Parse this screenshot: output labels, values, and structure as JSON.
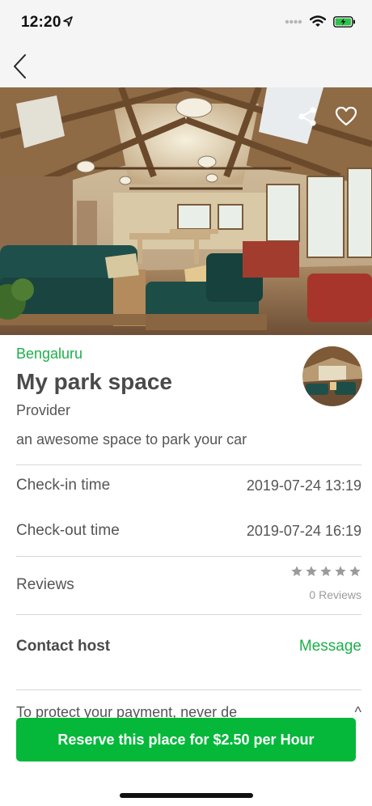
{
  "status_bar": {
    "time": "12:20",
    "icons": [
      "location-arrow-icon",
      "signal-dots-icon",
      "wifi-icon",
      "battery-charging-icon"
    ]
  },
  "nav": {
    "back_icon": "chevron-left-icon"
  },
  "hero": {
    "share_icon": "share-icon",
    "favorite_icon": "heart-outline-icon"
  },
  "listing": {
    "city": "Bengaluru",
    "title": "My park space",
    "provider": "Provider",
    "description": "an awesome space to park your car"
  },
  "details": {
    "checkin_label": "Check-in time",
    "checkin_value": "2019-07-24 13:19",
    "checkout_label": "Check-out time",
    "checkout_value": "2019-07-24 16:19",
    "reviews_label": "Reviews",
    "rating": 0,
    "max_rating": 5,
    "review_count": "0 Reviews"
  },
  "contact": {
    "label": "Contact host",
    "message_link": "Message"
  },
  "partial": {
    "text": "To protect your payment, never de",
    "right_char": "^"
  },
  "cta": {
    "reserve_label": "Reserve this place for $2.50 per Hour"
  },
  "colors": {
    "accent": "#1db04a",
    "button": "#05b83a",
    "divider": "#d6d6d6",
    "star_empty": "#9b9b9b"
  }
}
